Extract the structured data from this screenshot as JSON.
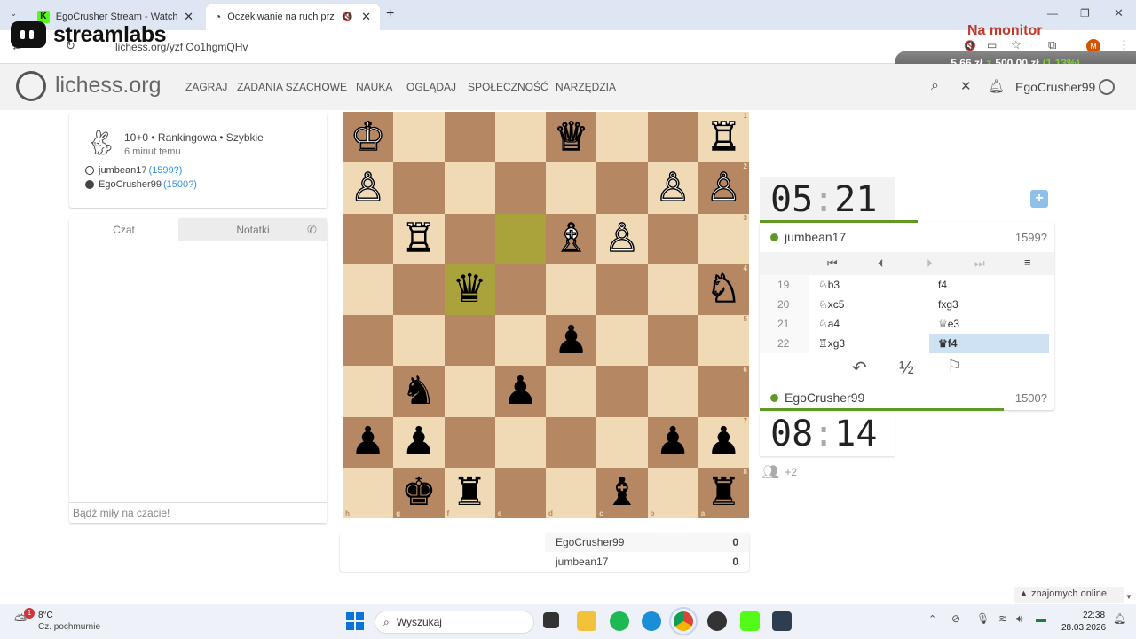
{
  "browser": {
    "tabs": [
      {
        "title": "EgoCrusher Stream - Watch Liv"
      },
      {
        "title": "Oczekiwanie na ruch przeci"
      }
    ],
    "url": "lichess.org/yzf Oo1hgmQHv"
  },
  "overlay": {
    "streamlabs": "streamlabs",
    "monitor": "Na monitor",
    "donation_amount": "5,66 zł",
    "donation_z": "z",
    "donation_goal": "500,00 zł",
    "donation_pct": "(1.13%)",
    "donation_fraction": 0.0113
  },
  "lichess": {
    "logo": "lichess.org",
    "nav": [
      "ZAGRAJ",
      "ZADANIA SZACHOWE",
      "NAUKA",
      "OGLĄDAJ",
      "SPOŁECZNOŚĆ",
      "NARZĘDZIA"
    ],
    "username": "EgoCrusher99"
  },
  "game_info": {
    "mode": "10+0 • Rankingowa • Szybkie",
    "ago": "6 minut temu",
    "white_player": "jumbean17",
    "white_rating": "(1599?)",
    "black_player": "EgoCrusher99",
    "black_rating": "(1500?)"
  },
  "chat": {
    "tab_chat": "Czat",
    "tab_notes": "Notatki",
    "placeholder": "Bądź miły na czacie!"
  },
  "board": {
    "orientation": "black",
    "rank_labels": [
      "1",
      "2",
      "3",
      "4",
      "5",
      "6",
      "7",
      "8"
    ],
    "file_labels": [
      "h",
      "g",
      "f",
      "e",
      "d",
      "c",
      "b",
      "a"
    ],
    "pieces": [
      {
        "sq": "h1",
        "p": "♔",
        "c": "w"
      },
      {
        "sq": "d1",
        "p": "♕",
        "c": "w"
      },
      {
        "sq": "a1",
        "p": "♖",
        "c": "w"
      },
      {
        "sq": "h2",
        "p": "♙",
        "c": "w"
      },
      {
        "sq": "b2",
        "p": "♙",
        "c": "w"
      },
      {
        "sq": "a2",
        "p": "♙",
        "c": "w"
      },
      {
        "sq": "g3",
        "p": "♖",
        "c": "w"
      },
      {
        "sq": "d3",
        "p": "♗",
        "c": "w"
      },
      {
        "sq": "c3",
        "p": "♙",
        "c": "w"
      },
      {
        "sq": "f4",
        "p": "♛",
        "c": "b"
      },
      {
        "sq": "a4",
        "p": "♘",
        "c": "w"
      },
      {
        "sq": "d5",
        "p": "♟",
        "c": "b"
      },
      {
        "sq": "g6",
        "p": "♞",
        "c": "b"
      },
      {
        "sq": "e6",
        "p": "♟",
        "c": "b"
      },
      {
        "sq": "h7",
        "p": "♟",
        "c": "b"
      },
      {
        "sq": "g7",
        "p": "♟",
        "c": "b"
      },
      {
        "sq": "b7",
        "p": "♟",
        "c": "b"
      },
      {
        "sq": "a7",
        "p": "♟",
        "c": "b"
      },
      {
        "sq": "g8",
        "p": "♚",
        "c": "b"
      },
      {
        "sq": "f8",
        "p": "♜",
        "c": "b"
      },
      {
        "sq": "c8",
        "p": "♝",
        "c": "b"
      },
      {
        "sq": "a8",
        "p": "♜",
        "c": "b"
      }
    ],
    "highlights": [
      "e3",
      "f4"
    ]
  },
  "score": {
    "rows": [
      {
        "name": "EgoCrusher99",
        "score": "0"
      },
      {
        "name": "jumbean17",
        "score": "0"
      }
    ]
  },
  "top_clock": {
    "time_min": "05",
    "time_sec": "21",
    "player": "jumbean17",
    "rating": "1599?"
  },
  "bottom_clock": {
    "time_min": "08",
    "time_sec": "14",
    "player": "EgoCrusher99",
    "rating": "1500?"
  },
  "moves": [
    {
      "n": "19",
      "w": "♘b3",
      "b": "f4"
    },
    {
      "n": "20",
      "w": "♘xc5",
      "b": "fxg3"
    },
    {
      "n": "21",
      "w": "♘a4",
      "b": "♕e3"
    },
    {
      "n": "22",
      "w": "♖xg3",
      "b": "♛f4"
    }
  ],
  "actions": {
    "draw": "½"
  },
  "spectators": "+2",
  "friends": "znajomych online",
  "taskbar": {
    "weather_temp": "8°C",
    "weather_desc": "Cz. pochmurnie",
    "search": "Wyszukaj",
    "time": "22:38",
    "date": "28.03.2026",
    "badge": "1"
  },
  "colors": {
    "accent_green": "#629924",
    "highlight": "#aaa23a",
    "light_sq": "#f0d9b5",
    "dark_sq": "#b58863"
  }
}
